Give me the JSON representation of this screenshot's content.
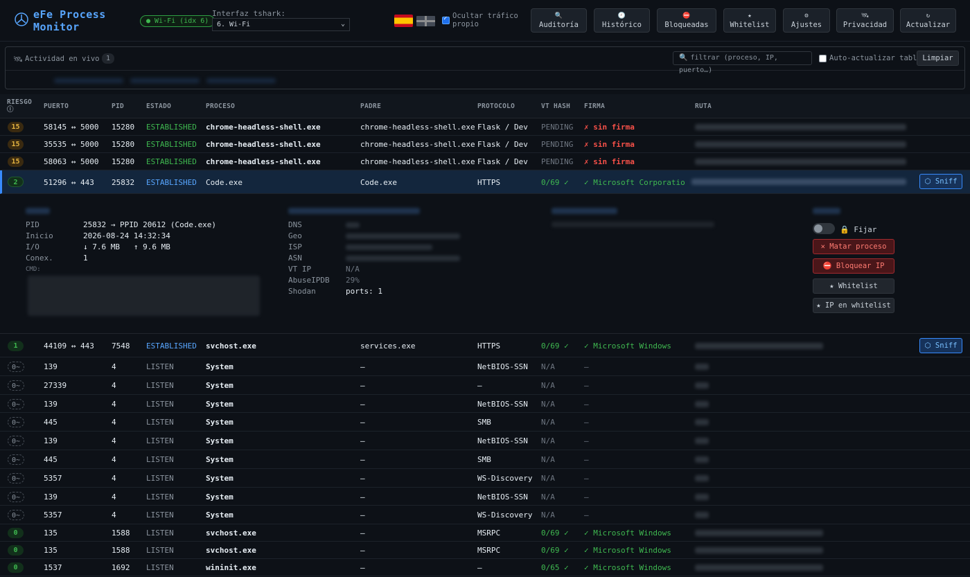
{
  "app": {
    "title": "eFe Process Monitor",
    "wifi_badge": "● Wi-Fi (idx 6)",
    "tshark_label": "Interfaz tshark:",
    "tshark_value": "6. Wi-Fi",
    "hide_own_label": "Ocultar tráfico propio"
  },
  "toolbar": [
    {
      "icon": "🔍",
      "label": "Auditoría"
    },
    {
      "icon": "🕘",
      "label": "Histórico"
    },
    {
      "icon": "⛔",
      "label": "Bloqueadas"
    },
    {
      "icon": "★",
      "label": "Whitelist"
    },
    {
      "icon": "⚙",
      "label": "Ajustes"
    },
    {
      "icon": "🛰",
      "label": "Privacidad"
    },
    {
      "icon": "↻",
      "label": "Actualizar"
    }
  ],
  "live": {
    "label": "Actividad en vivo",
    "count": "1",
    "filter_placeholder": "filtrar (proceso, IP, puerto…)",
    "auto_refresh": "Auto-actualizar tabla",
    "clear": "Limpiar"
  },
  "columns": [
    "RIESGO ⓘ",
    "PUERTO",
    "PID",
    "ESTADO",
    "PROCESO",
    "PADRE",
    "PROTOCOLO",
    "VT HASH",
    "FIRMA",
    "RUTA"
  ],
  "rows_top": [
    {
      "risk": "15",
      "port": "58145 ↔ 5000",
      "pid": "15280",
      "state": "ESTABLISHED",
      "proc": "chrome-headless-shell.exe",
      "parent": "chrome-headless-shell.exe",
      "proto": "Flask / Dev",
      "vt": "PENDING",
      "sig": "✗ sin firma"
    },
    {
      "risk": "15",
      "port": "35535 ↔ 5000",
      "pid": "15280",
      "state": "ESTABLISHED",
      "proc": "chrome-headless-shell.exe",
      "parent": "chrome-headless-shell.exe",
      "proto": "Flask / Dev",
      "vt": "PENDING",
      "sig": "✗ sin firma"
    },
    {
      "risk": "15",
      "port": "58063 ↔ 5000",
      "pid": "15280",
      "state": "ESTABLISHED",
      "proc": "chrome-headless-shell.exe",
      "parent": "chrome-headless-shell.exe",
      "proto": "Flask / Dev",
      "vt": "PENDING",
      "sig": "✗ sin firma"
    }
  ],
  "selected_row": {
    "risk": "2",
    "port": "51296 ↔ 443",
    "pid": "25832",
    "state": "ESTABLISHED",
    "proc": "Code.exe",
    "parent": "Code.exe",
    "proto": "HTTPS",
    "vt": "0/69 ✓",
    "sig": "✓ Microsoft Corporatio…",
    "sniff": "⬡ Sniff"
  },
  "detail": {
    "pid_k": "PID",
    "pid_v": "25832 → PPID 20612 (Code.exe)",
    "start_k": "Inicio",
    "start_v": "2026-08-24 14:32:34",
    "io_k": "I/O",
    "io_v": "↓ 7.6 MB   ↑ 9.6 MB",
    "conn_k": "Conex.",
    "conn_v": "1",
    "cmd_k": "CMD:",
    "dns_k": "DNS",
    "geo_k": "Geo",
    "isp_k": "ISP",
    "asn_k": "ASN",
    "vtip_k": "VT IP",
    "vtip_v": "N/A",
    "abuse_k": "AbuseIPDB",
    "abuse_v": "29%",
    "shodan_k": "Shodan",
    "shodan_v": "ports: 1",
    "pin_label": "🔒 Fijar",
    "kill": "✕ Matar proceso",
    "block": "⛔ Bloquear IP",
    "whitelist": "★ Whitelist",
    "ip_whitelist": "★ IP en whitelist"
  },
  "rows_bottom": [
    {
      "risk": "1",
      "port": "44109 ↔ 443",
      "pid": "7548",
      "state": "ESTABLISHED",
      "proc": "svchost.exe",
      "parent": "services.exe",
      "proto": "HTTPS",
      "vt": "0/69 ✓",
      "sig": "✓ Microsoft Windows",
      "sniff": "⬡ Sniff"
    },
    {
      "risk": "0~",
      "port": "139",
      "pid": "4",
      "state": "LISTEN",
      "proc": "System",
      "parent": "—",
      "proto": "NetBIOS-SSN",
      "vt": "N/A",
      "sig": "—"
    },
    {
      "risk": "0~",
      "port": "27339",
      "pid": "4",
      "state": "LISTEN",
      "proc": "System",
      "parent": "—",
      "proto": "—",
      "vt": "N/A",
      "sig": "—"
    },
    {
      "risk": "0~",
      "port": "139",
      "pid": "4",
      "state": "LISTEN",
      "proc": "System",
      "parent": "—",
      "proto": "NetBIOS-SSN",
      "vt": "N/A",
      "sig": "—"
    },
    {
      "risk": "0~",
      "port": "445",
      "pid": "4",
      "state": "LISTEN",
      "proc": "System",
      "parent": "—",
      "proto": "SMB",
      "vt": "N/A",
      "sig": "—"
    },
    {
      "risk": "0~",
      "port": "139",
      "pid": "4",
      "state": "LISTEN",
      "proc": "System",
      "parent": "—",
      "proto": "NetBIOS-SSN",
      "vt": "N/A",
      "sig": "—"
    },
    {
      "risk": "0~",
      "port": "445",
      "pid": "4",
      "state": "LISTEN",
      "proc": "System",
      "parent": "—",
      "proto": "SMB",
      "vt": "N/A",
      "sig": "—"
    },
    {
      "risk": "0~",
      "port": "5357",
      "pid": "4",
      "state": "LISTEN",
      "proc": "System",
      "parent": "—",
      "proto": "WS-Discovery",
      "vt": "N/A",
      "sig": "—"
    },
    {
      "risk": "0~",
      "port": "139",
      "pid": "4",
      "state": "LISTEN",
      "proc": "System",
      "parent": "—",
      "proto": "NetBIOS-SSN",
      "vt": "N/A",
      "sig": "—"
    },
    {
      "risk": "0~",
      "port": "5357",
      "pid": "4",
      "state": "LISTEN",
      "proc": "System",
      "parent": "—",
      "proto": "WS-Discovery",
      "vt": "N/A",
      "sig": "—"
    },
    {
      "risk": "0",
      "port": "135",
      "pid": "1588",
      "state": "LISTEN",
      "proc": "svchost.exe",
      "parent": "—",
      "proto": "MSRPC",
      "vt": "0/69 ✓",
      "sig": "✓ Microsoft Windows"
    },
    {
      "risk": "0",
      "port": "135",
      "pid": "1588",
      "state": "LISTEN",
      "proc": "svchost.exe",
      "parent": "—",
      "proto": "MSRPC",
      "vt": "0/69 ✓",
      "sig": "✓ Microsoft Windows"
    },
    {
      "risk": "0",
      "port": "1537",
      "pid": "1692",
      "state": "LISTEN",
      "proc": "wininit.exe",
      "parent": "—",
      "proto": "—",
      "vt": "0/65 ✓",
      "sig": "✓ Microsoft Windows"
    }
  ]
}
